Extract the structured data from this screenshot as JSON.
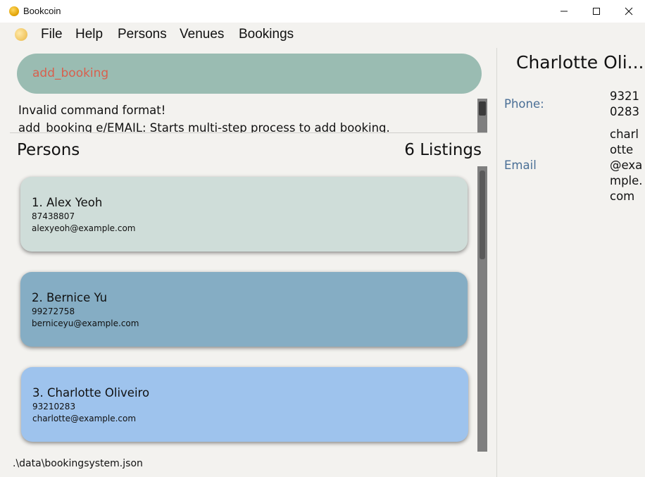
{
  "window": {
    "title": "Bookcoin"
  },
  "menu": {
    "items": [
      "File",
      "Help",
      "Persons",
      "Venues",
      "Bookings"
    ]
  },
  "command": {
    "input_value": "add_booking"
  },
  "result": {
    "lines": [
      "Invalid command format!",
      "add_booking e/EMAIL: Starts multi-step process to add booking."
    ]
  },
  "list": {
    "title": "Persons",
    "count": "6 Listings",
    "persons": [
      {
        "index_name": "1.  Alex Yeoh",
        "phone": "87438807",
        "email": "alexyeoh@example.com",
        "color": "#cfddd9"
      },
      {
        "index_name": "2.  Bernice Yu",
        "phone": "99272758",
        "email": "berniceyu@example.com",
        "color": "#85adc4"
      },
      {
        "index_name": "3.  Charlotte Oliveiro",
        "phone": "93210283",
        "email": "charlotte@example.com",
        "color": "#9ec3ed"
      }
    ]
  },
  "status": {
    "path": ".\\data\\bookingsystem.json"
  },
  "detail": {
    "name": "Charlotte Oli...",
    "phone_label": "Phone:",
    "phone_lines": [
      "9321",
      "0283"
    ],
    "email_label": "Email",
    "email_lines": [
      "charl",
      "otte",
      "@exa",
      "mple.",
      "com"
    ]
  },
  "icons": {
    "app": "coin-icon",
    "minimize": "minimize-icon",
    "maximize": "maximize-icon",
    "close": "close-icon"
  }
}
